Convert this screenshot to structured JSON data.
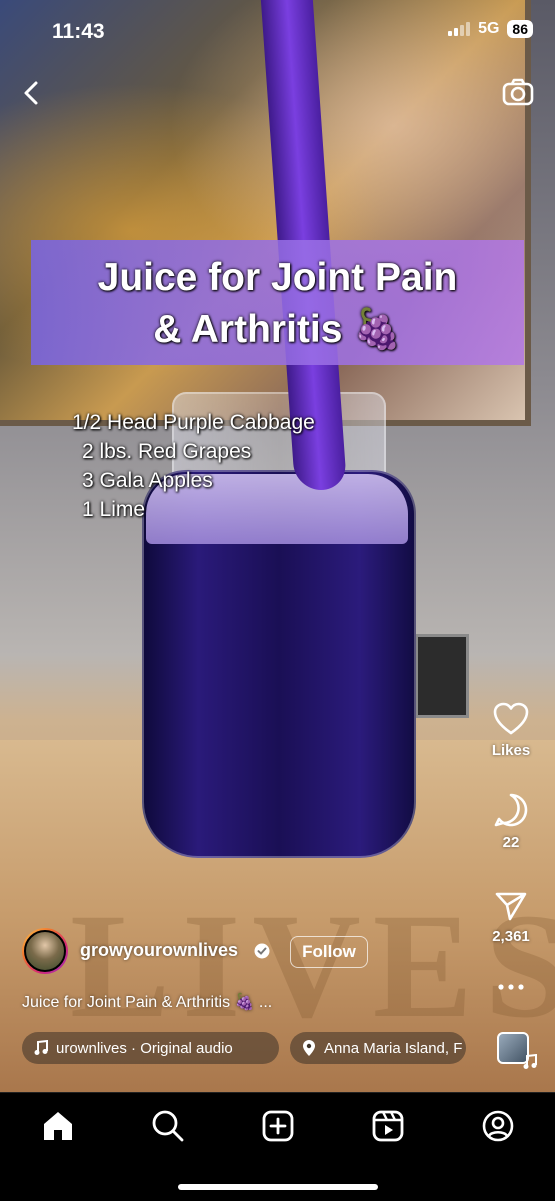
{
  "status_bar": {
    "time": "11:43",
    "network": "5G",
    "battery": "86"
  },
  "reel": {
    "title_overlay": [
      "Juice for Joint Pain",
      "& Arthritis 🍇"
    ],
    "ingredients": [
      "1/2 Head Purple Cabbage",
      "2 lbs. Red Grapes",
      "3 Gala Apples",
      "1 Lime"
    ],
    "table_watermark": "LIVES"
  },
  "actions": {
    "likes_label": "Likes",
    "comments_count": "22",
    "shares_count": "2,361"
  },
  "author": {
    "username": "growyourownlives",
    "follow_label": "Follow"
  },
  "caption": "Juice for Joint Pain & Arthritis 🍇 ...",
  "audio_label": "urownlives · Original audio",
  "location_label": "Anna Maria Island, F",
  "icons": [
    "back-icon",
    "camera-icon",
    "heart-icon",
    "comment-icon",
    "share-icon",
    "more-icon",
    "music-note-icon",
    "location-pin-icon",
    "home-icon",
    "search-icon",
    "create-icon",
    "reels-icon",
    "profile-icon"
  ]
}
